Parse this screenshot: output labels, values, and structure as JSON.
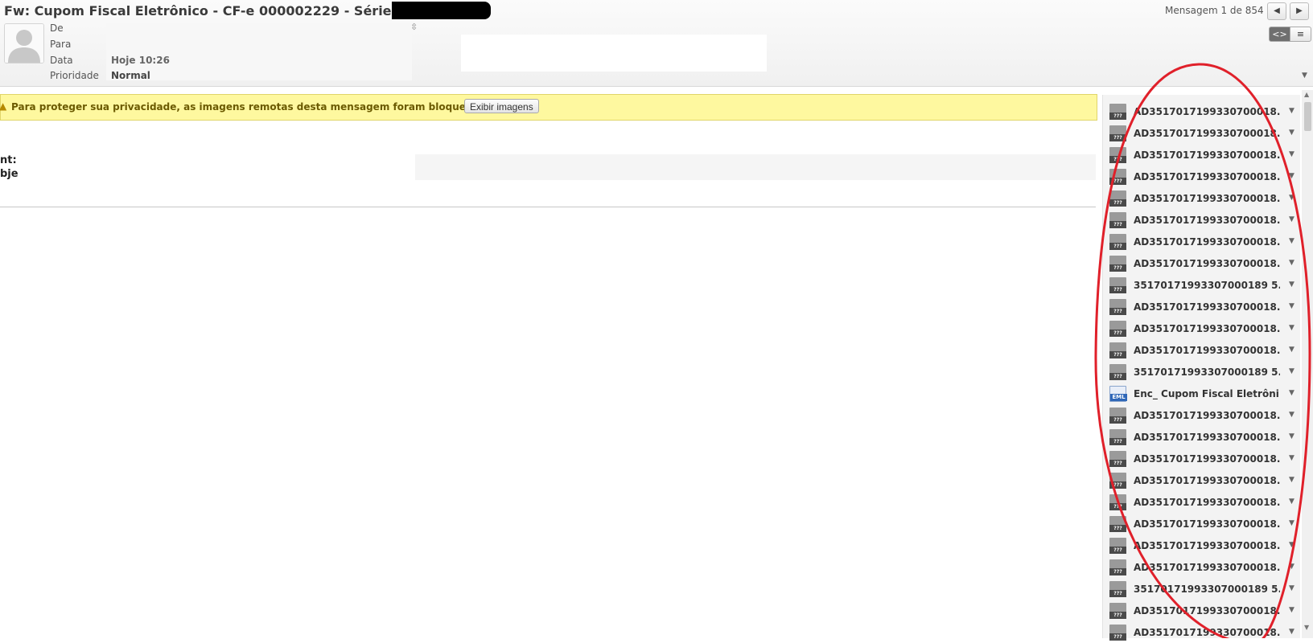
{
  "header": {
    "subject": "Fw: Cupom Fiscal Eletrônico - CF-e 000002229 - Série 1 -",
    "counter": "Mensagem 1 de 854",
    "fields": [
      {
        "label": "De",
        "value": ""
      },
      {
        "label": "Para",
        "value": ""
      },
      {
        "label": "Data",
        "value": "Hoje 10:26"
      },
      {
        "label": "Prioridade",
        "value": "Normal"
      }
    ],
    "prev_glyph": "◀",
    "next_glyph": "▶",
    "view_html_glyph": "<>",
    "view_list_glyph": "≡"
  },
  "notice": {
    "text": "Para proteger sua privacidade, as imagens remotas desta mensagem foram bloqueadas.",
    "button": "Exibir imagens"
  },
  "body": {
    "sent_label": "nt:",
    "subject_label": "bje"
  },
  "attachments": [
    {
      "name": "AD3517017199330700018...",
      "type": "???"
    },
    {
      "name": "AD3517017199330700018...",
      "type": "???"
    },
    {
      "name": "AD3517017199330700018...",
      "type": "???"
    },
    {
      "name": "AD3517017199330700018...",
      "type": "???"
    },
    {
      "name": "AD3517017199330700018...",
      "type": "???"
    },
    {
      "name": "AD3517017199330700018...",
      "type": "???"
    },
    {
      "name": "AD3517017199330700018...",
      "type": "???"
    },
    {
      "name": "AD3517017199330700018...",
      "type": "???"
    },
    {
      "name": "35170171993307000189 5...",
      "type": "???"
    },
    {
      "name": "AD3517017199330700018...",
      "type": "???"
    },
    {
      "name": "AD3517017199330700018...",
      "type": "???"
    },
    {
      "name": "AD3517017199330700018...",
      "type": "???"
    },
    {
      "name": "35170171993307000189 5...",
      "type": "???"
    },
    {
      "name": "Enc_ Cupom Fiscal Eletrôni...",
      "type": "EML"
    },
    {
      "name": "AD3517017199330700018...",
      "type": "???"
    },
    {
      "name": "AD3517017199330700018...",
      "type": "???"
    },
    {
      "name": "AD3517017199330700018...",
      "type": "???"
    },
    {
      "name": "AD3517017199330700018...",
      "type": "???"
    },
    {
      "name": "AD3517017199330700018...",
      "type": "???"
    },
    {
      "name": "AD3517017199330700018...",
      "type": "???"
    },
    {
      "name": "AD3517017199330700018...",
      "type": "???"
    },
    {
      "name": "AD3517017199330700018...",
      "type": "???"
    },
    {
      "name": "35170171993307000189 5...",
      "type": "???"
    },
    {
      "name": "AD3517017199330700018...",
      "type": "???"
    },
    {
      "name": "AD3517017199330700018...",
      "type": "???"
    }
  ],
  "colors": {
    "notice_bg": "#fef89f",
    "annotation": "#e0202a"
  }
}
